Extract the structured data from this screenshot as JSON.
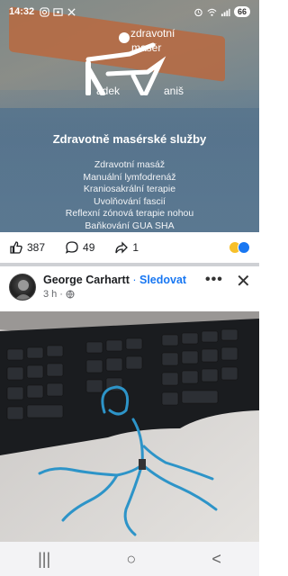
{
  "status_bar": {
    "time": "14:32",
    "battery": "66",
    "left_icons": [
      "instagram-icon",
      "screenshot-icon",
      "x-icon"
    ],
    "right_icons": [
      "alarm-icon",
      "wifi-icon",
      "signal-icon",
      "battery-icon"
    ]
  },
  "ad_post": {
    "logo": {
      "line1": "zdravotní",
      "line2": "masér",
      "name_left": "adek",
      "name_right": "aniš"
    },
    "title": "Zdravotně masérské služby",
    "services": [
      "Zdravotní masáž",
      "Manuální lymfodrenáž",
      "Kraniosakrální terapie",
      "Uvolňování fascií",
      "Reflexní zónová terapie nohou",
      "Baňkování GUA SHA"
    ],
    "likes": "387",
    "comments": "49",
    "shares": "1"
  },
  "post2": {
    "author": "George Carhartt",
    "separator": "·",
    "follow_label": "Sledovat",
    "time": "3 h",
    "dot": "·"
  },
  "nav": {
    "recent": "|||",
    "home": "○",
    "back": "<"
  }
}
